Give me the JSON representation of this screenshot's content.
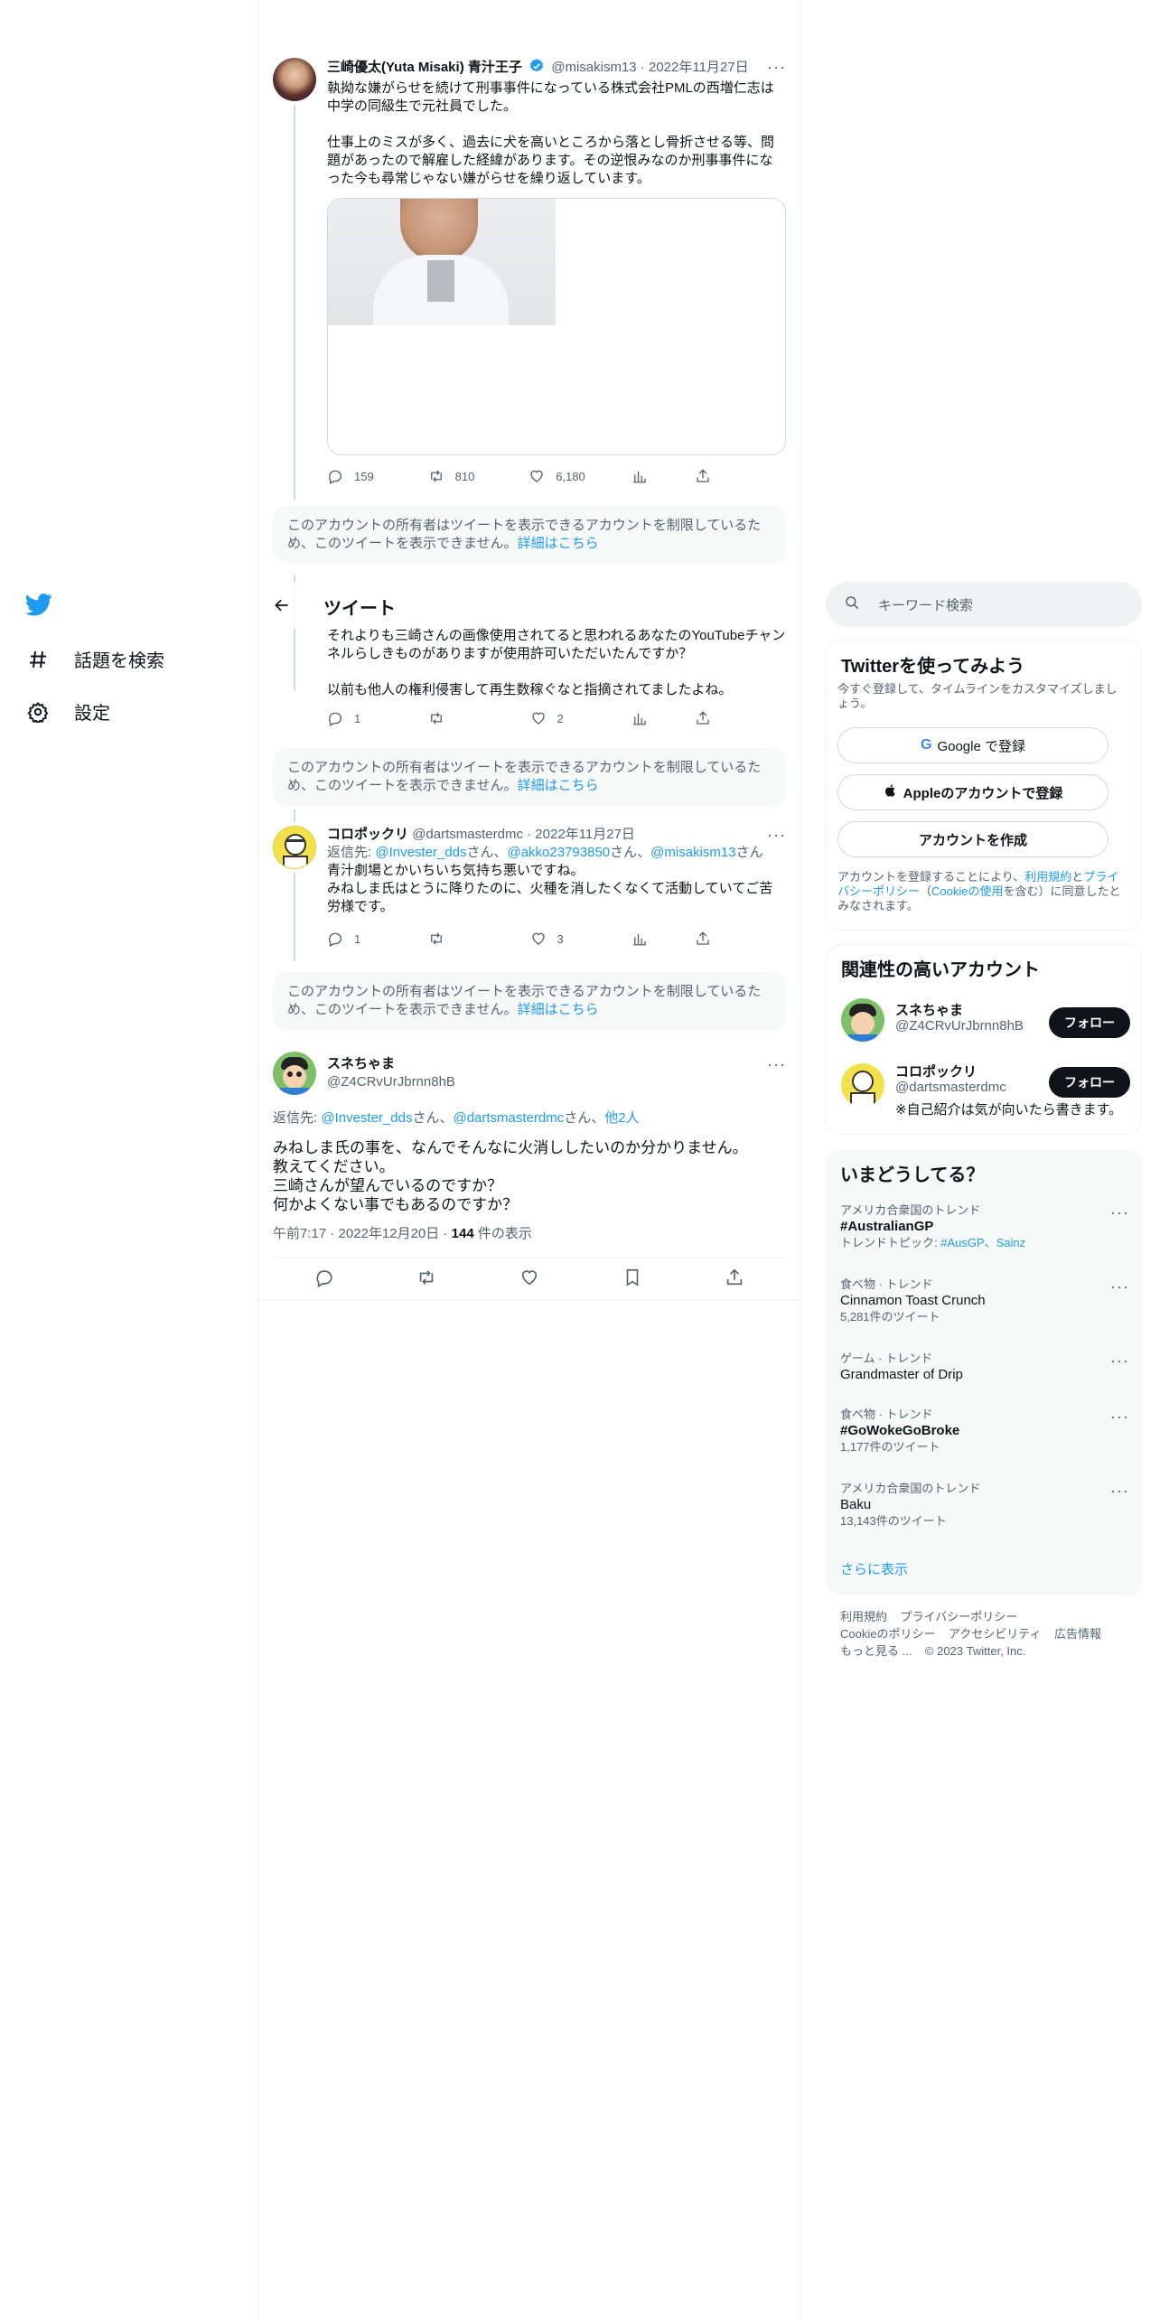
{
  "nav": {
    "explore_label": "話題を検索",
    "settings_label": "設定"
  },
  "header": {
    "title": "ツイート"
  },
  "tweets": [
    {
      "name": "三崎優太(Yuta Misaki) 青汁王子",
      "handle": "@misakism13",
      "date": "2022年11月27日",
      "text": "執拗な嫌がらせを続けて刑事事件になっている株式会社PMLの西増仁志は中学の同級生で元社員でした。\n\n仕事上のミスが多く、過去に犬を高いところから落とし骨折させる等、問題があったので解雇した経緯があります。その逆恨みなのか刑事事件になった今も尋常じゃない嫌がらせを繰り返しています。",
      "replies": "159",
      "retweets": "810",
      "likes": "6,180"
    },
    {
      "text": "それよりも三崎さんの画像使用されてると思われるあなたのYouTubeチャンネルらしきものがありますが使用許可いただいたんですか？\n\n以前も他人の権利侵害して再生数稼ぐなと指摘されてましたよね。",
      "replies": "1",
      "retweets": "",
      "likes": "2"
    },
    {
      "name": "コロポックリ",
      "handle": "@dartsmasterdmc",
      "date": "2022年11月27日",
      "reply_prefix": "返信先: ",
      "reply_to_1": "@Invester_dds",
      "reply_sep_1": "さん、",
      "reply_to_2": "@akko23793850",
      "reply_sep_2": "さん、",
      "reply_to_3": "@misakism13",
      "reply_suffix": "さん",
      "text": "青汁劇場とかいちいち気持ち悪いですね。\nみねしま氏はとうに降りたのに、火種を消したくなくて活動していてご苦労様です。",
      "replies": "1",
      "retweets": "",
      "likes": "3"
    }
  ],
  "notice": {
    "text": "このアカウントの所有者はツイートを表示できるアカウントを制限しているため、このツイートを表示できません。",
    "link": "詳細はこちら"
  },
  "main_tweet": {
    "name": "スネちゃま",
    "handle": "@Z4CRvUrJbrnn8hB",
    "reply_prefix": "返信先: ",
    "reply_to_1": "@Invester_dds",
    "reply_sep_1": "さん、",
    "reply_to_2": "@dartsmasterdmc",
    "reply_sep_2": "さん、",
    "reply_others": "他2人",
    "text": "みねしま氏の事を、なんでそんなに火消ししたいのか分かりません。\n教えてください。\n三崎さんが望んでいるのですか？\n何かよくない事でもあるのですか？",
    "time": "午前7:17",
    "date": "2022年12月20日",
    "views": "144",
    "views_label": " 件の表示"
  },
  "search": {
    "placeholder": "キーワード検索"
  },
  "signup": {
    "title": "Twitterを使ってみよう",
    "subtitle": "今すぐ登録して、タイムラインをカスタマイズしましょう。",
    "google": "Google で登録",
    "apple": "Appleのアカウントで登録",
    "create": "アカウントを作成",
    "legal_1": "アカウントを登録することにより、",
    "terms": "利用規約",
    "legal_2": "と",
    "privacy": "プライバシーポリシー",
    "legal_3": "（",
    "cookie": "Cookieの使用",
    "legal_4": "を含む）に同意したとみなされます。"
  },
  "related": {
    "title": "関連性の高いアカウント",
    "accounts": [
      {
        "name": "スネちゃま",
        "handle": "@Z4CRvUrJbrnn8hB",
        "bio": "",
        "follow": "フォロー"
      },
      {
        "name": "コロポックリ",
        "handle": "@dartsmasterdmc",
        "bio": "※自己紹介は気が向いたら書きます。",
        "follow": "フォロー"
      }
    ]
  },
  "trends": {
    "title": "いまどうしてる？",
    "items": [
      {
        "category": "アメリカ合衆国のトレンド",
        "name": "#AustralianGP",
        "extra_prefix": "トレンドトピック: ",
        "extra_link": "#AusGP、Sainz"
      },
      {
        "category": "食べ物 · トレンド",
        "name": "Cinnamon Toast Crunch",
        "count": "5,281件のツイート"
      },
      {
        "category": "ゲーム · トレンド",
        "name": "Grandmaster of Drip",
        "count": ""
      },
      {
        "category": "食べ物 · トレンド",
        "name": "#GoWokeGoBroke",
        "count": "1,177件のツイート"
      },
      {
        "category": "アメリカ合衆国のトレンド",
        "name": "Baku",
        "count": "13,143件のツイート"
      }
    ],
    "show_more": "さらに表示"
  },
  "footer": {
    "terms": "利用規約",
    "privacy": "プライバシーポリシー",
    "cookie": "Cookieのポリシー",
    "accessibility": "アクセシビリティ",
    "ads": "広告情報",
    "more": "もっと見る ...",
    "copyright": "© 2023 Twitter, Inc."
  },
  "colors": {
    "accent": "#1d9bf0",
    "text": "#0f1419",
    "muted": "#536471",
    "panel_bg": "#f7f9f9"
  }
}
